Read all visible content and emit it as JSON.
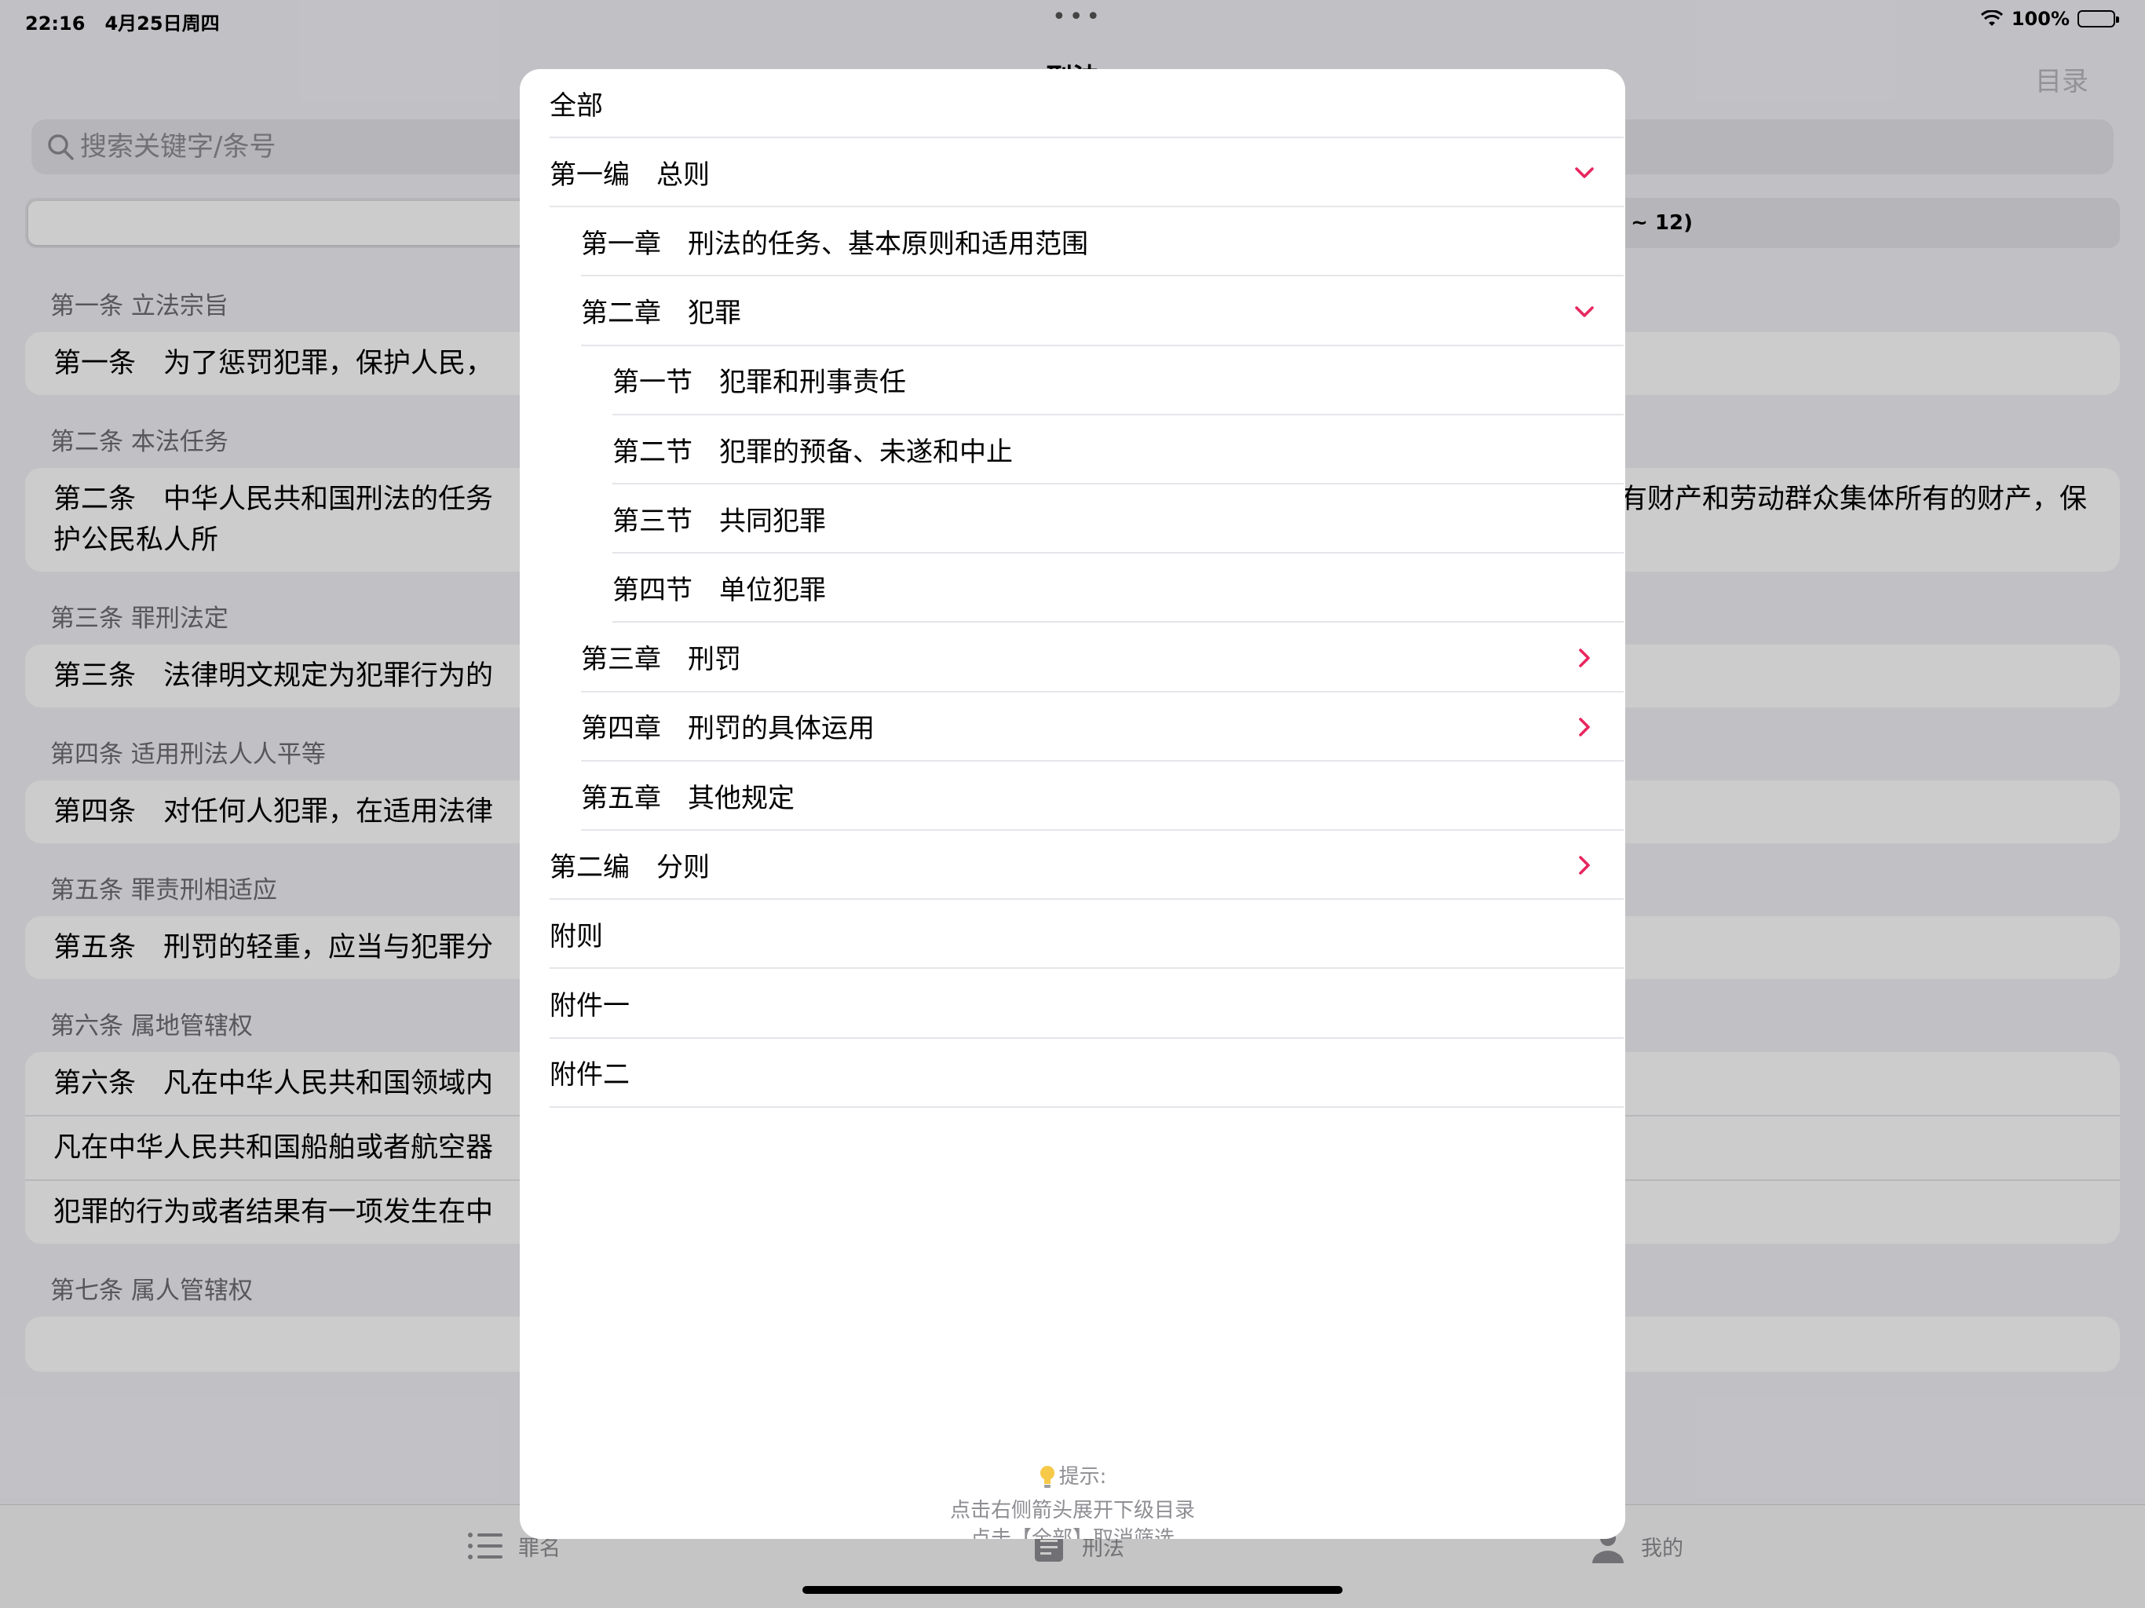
{
  "status_bar": {
    "time": "22:16",
    "date": "4月25日周四",
    "battery": "100%",
    "battery_level": 1.0
  },
  "nav": {
    "title": "刑法",
    "menu": "目录"
  },
  "search": {
    "placeholder": "搜索关键字/条号"
  },
  "segments": [
    {
      "label": "刑法"
    },
    {
      "label": "~ 12)"
    }
  ],
  "articles": [
    {
      "header": "第一条 立法宗旨",
      "paras": [
        "第一条　为了惩罚犯罪，保护人民，"
      ]
    },
    {
      "header": "第二条 本法任务",
      "paras": [
        "第二条　中华人民共和国刑法的任务　　　　　　　　　　　　　　　　　　　　　　　　　　　　　　　　会主义制度，保护国有财产和劳动群众集体所有的财产，保护公民私人所　　　　　　　　　　　　　　　　　　　　　　　　　　　　　　　　保障社会主义建设事业的顺利进行。"
      ]
    },
    {
      "header": "第三条 罪刑法定",
      "paras": [
        "第三条　法律明文规定为犯罪行为的"
      ]
    },
    {
      "header": "第四条 适用刑法人人平等",
      "paras": [
        "第四条　对任何人犯罪，在适用法律"
      ]
    },
    {
      "header": "第五条 罪责刑相适应",
      "paras": [
        "第五条　刑罚的轻重，应当与犯罪分"
      ]
    },
    {
      "header": "第六条 属地管辖权",
      "paras": [
        "第六条　凡在中华人民共和国领域内",
        "凡在中华人民共和国船舶或者航空器",
        "犯罪的行为或者结果有一项发生在中"
      ]
    },
    {
      "header": "第七条 属人管辖权",
      "paras": [
        ""
      ]
    }
  ],
  "tabs": [
    {
      "label": "罪名"
    },
    {
      "label": "刑法"
    },
    {
      "label": "我的"
    }
  ],
  "toc": {
    "accent_color": "#e8265e",
    "items": [
      {
        "label": "全部",
        "chevron": "none"
      },
      {
        "label": "第一编　总则",
        "chevron": "down"
      },
      {
        "label": "第一章　刑法的任务、基本原则和适用范围",
        "chevron": "none"
      },
      {
        "label": "第二章　犯罪",
        "chevron": "down"
      },
      {
        "label": "第一节　犯罪和刑事责任",
        "chevron": "none"
      },
      {
        "label": "第二节　犯罪的预备、未遂和中止",
        "chevron": "none"
      },
      {
        "label": "第三节　共同犯罪",
        "chevron": "none"
      },
      {
        "label": "第四节　单位犯罪",
        "chevron": "none"
      },
      {
        "label": "第三章　刑罚",
        "chevron": "right"
      },
      {
        "label": "第四章　刑罚的具体运用",
        "chevron": "right"
      },
      {
        "label": "第五章　其他规定",
        "chevron": "none"
      },
      {
        "label": "第二编　分则",
        "chevron": "right"
      },
      {
        "label": "附则",
        "chevron": "none"
      },
      {
        "label": "附件一",
        "chevron": "none"
      },
      {
        "label": "附件二",
        "chevron": "none"
      }
    ],
    "hint": {
      "title": "提示:",
      "line1": "点击右侧箭头展开下级目录",
      "line2": "点击【全部】取消筛选"
    }
  }
}
